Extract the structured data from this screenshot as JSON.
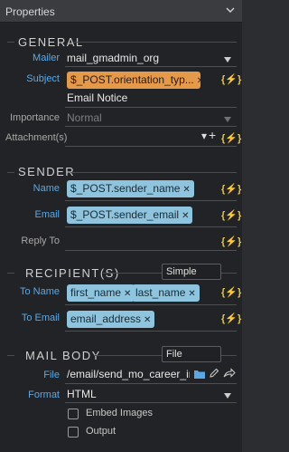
{
  "panel": {
    "title": "Properties"
  },
  "general": {
    "heading": "GENERAL",
    "mailer_label": "Mailer",
    "mailer_value": "mail_gmadmin_org",
    "subject_label": "Subject",
    "subject_tag": "$_POST.orientation_typ...",
    "subject_text": "Email Notice",
    "importance_label": "Importance",
    "importance_value": "Normal",
    "attachments_label": "Attachment(s)"
  },
  "sender": {
    "heading": "SENDER",
    "name_label": "Name",
    "name_tag": "$_POST.sender_name",
    "email_label": "Email",
    "email_tag": "$_POST.sender_email",
    "replyto_label": "Reply To"
  },
  "recipients": {
    "heading": "RECIPIENT(S)",
    "tooltip": "Simple",
    "to_name_label": "To Name",
    "to_name_tags": [
      "first_name",
      "last_name"
    ],
    "to_email_label": "To Email",
    "to_email_tags": [
      "email_address"
    ]
  },
  "mail_body": {
    "heading": "MAIL BODY",
    "tooltip": "File",
    "file_label": "File",
    "file_value": "/email/send_mo_career_inbou",
    "format_label": "Format",
    "format_value": "HTML",
    "embed_images_label": "Embed Images",
    "output_label": "Output"
  },
  "icons": {
    "dynamic": "lightning-bolt-icon",
    "remove": "close-icon",
    "folder": "folder-icon",
    "edit": "pencil-icon",
    "share": "share-arrow-icon",
    "add": "plus-icon",
    "collapse": "chevron-down-icon"
  },
  "colors": {
    "label_blue": "#5aa9e6",
    "tag_blue": "#8ec4de",
    "tag_orange": "#e59a49",
    "bolt_yellow": "#e5c84a"
  }
}
